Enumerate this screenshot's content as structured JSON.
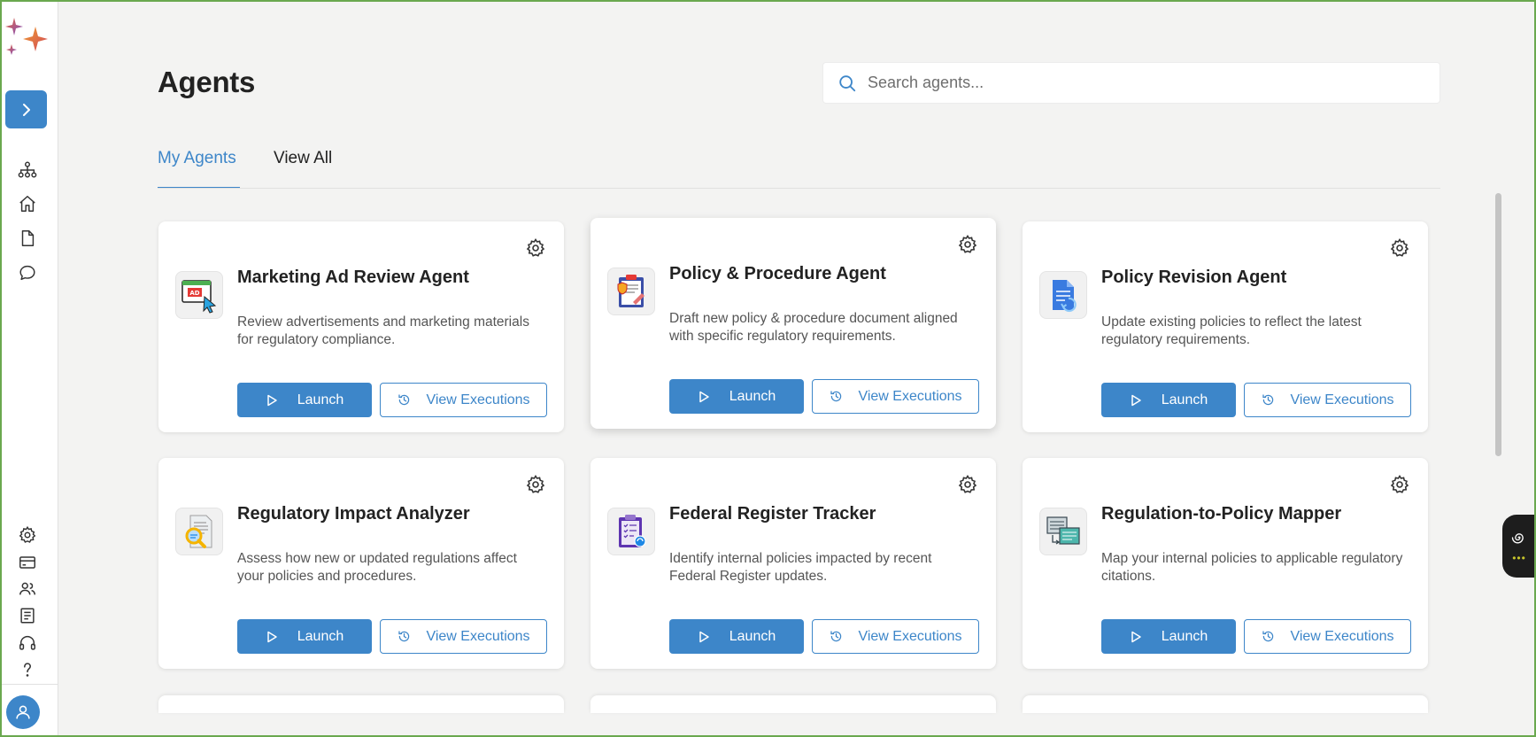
{
  "header": {
    "title": "Agents",
    "search_placeholder": "Search agents..."
  },
  "tabs": [
    {
      "label": "My Agents",
      "active": true
    },
    {
      "label": "View All",
      "active": false
    }
  ],
  "sidebar": {
    "top_icons": [
      "org-chart-icon",
      "home-icon",
      "document-icon",
      "chat-icon"
    ],
    "bottom_icons": [
      "settings-icon",
      "credit-card-icon",
      "users-icon",
      "notes-icon",
      "headset-icon",
      "help-icon"
    ]
  },
  "buttons": {
    "launch": "Launch",
    "view_executions": "View Executions"
  },
  "agents": [
    {
      "title": "Marketing Ad Review Agent",
      "description": "Review advertisements and marketing materials for regulatory compliance.",
      "icon": "ad-review-icon"
    },
    {
      "title": "Policy & Procedure Agent",
      "description": "Draft new policy & procedure document aligned with specific regulatory requirements.",
      "icon": "policy-clipboard-icon"
    },
    {
      "title": "Policy Revision Agent",
      "description": "Update existing policies to reflect the latest regulatory requirements.",
      "icon": "document-revision-icon"
    },
    {
      "title": "Regulatory Impact Analyzer",
      "description": "Assess how new or updated regulations affect your policies and procedures.",
      "icon": "magnifier-document-icon"
    },
    {
      "title": "Federal Register Tracker",
      "description": "Identify internal policies impacted by recent Federal Register updates.",
      "icon": "clipboard-checklist-icon"
    },
    {
      "title": "Regulation-to-Policy Mapper",
      "description": "Map your internal policies to applicable regulatory citations.",
      "icon": "mapping-documents-icon"
    }
  ],
  "colors": {
    "accent": "#3d86c9",
    "background": "#f3f3f2",
    "card": "#ffffff"
  }
}
